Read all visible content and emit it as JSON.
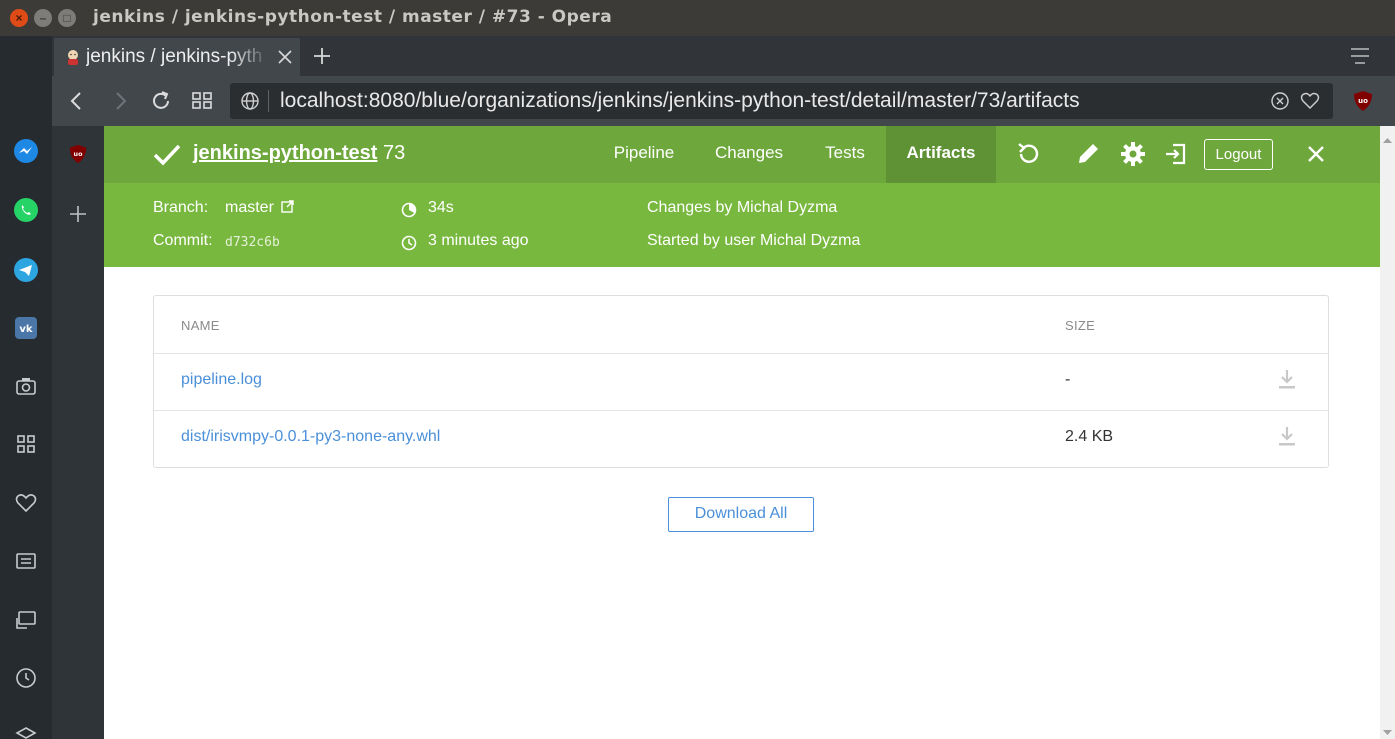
{
  "window": {
    "title": "jenkins / jenkins-python-test / master / #73 - Opera"
  },
  "browser": {
    "tab": {
      "title": "jenkins / jenkins-pyth"
    },
    "url": {
      "host": "localhost",
      "rest": ":8080/blue/organizations/jenkins/jenkins-python-test/detail/master/73/artifacts"
    }
  },
  "header": {
    "pipeline_name": "jenkins-python-test",
    "run_number": "73",
    "tabs": [
      {
        "label": "Pipeline"
      },
      {
        "label": "Changes"
      },
      {
        "label": "Tests"
      },
      {
        "label": "Artifacts"
      }
    ],
    "logout_label": "Logout"
  },
  "run_info": {
    "branch_label": "Branch:",
    "branch_value": "master",
    "commit_label": "Commit:",
    "commit_value": "d732c6b",
    "duration": "34s",
    "ago": "3 minutes ago",
    "changes_by": "Changes by Michal Dyzma",
    "started_by": "Started by user Michal Dyzma"
  },
  "artifacts": {
    "columns": {
      "name": "NAME",
      "size": "SIZE"
    },
    "rows": [
      {
        "name": "pipeline.log",
        "size": "-"
      },
      {
        "name": "dist/irisvmpy-0.0.1-py3-none-any.whl",
        "size": "2.4 KB"
      }
    ],
    "download_all_label": "Download All"
  },
  "colors": {
    "header_top": "#6ea83d",
    "header_bottom": "#78b83e",
    "active_tab": "#5e9234",
    "link": "#4a90d9"
  }
}
